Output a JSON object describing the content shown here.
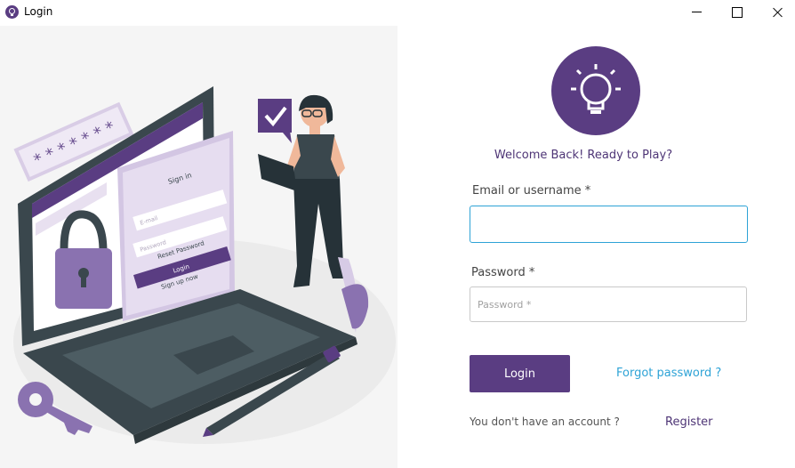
{
  "window": {
    "title": "Login",
    "icon": "lightbulb-icon"
  },
  "illustration": {
    "password_mask": "* * * * * * *",
    "form_title": "Sign in",
    "email_placeholder": "E-mail",
    "password_placeholder": "Password",
    "reset_label": "Reset Password",
    "login_label": "Login",
    "signup_label": "Sign up now"
  },
  "login": {
    "logo_icon": "lightbulb-icon",
    "welcome": "Welcome Back! Ready to Play?",
    "email_label": "Email or username *",
    "email_value": "",
    "password_label": "Password *",
    "password_placeholder": "Password *",
    "login_button": "Login",
    "forgot_password": "Forgot password ?",
    "no_account": "You don't have an account ?",
    "register": "Register"
  },
  "colors": {
    "brand": "#5a3d82",
    "link": "#2ea3d6",
    "focus_border": "#2ea3d6"
  }
}
